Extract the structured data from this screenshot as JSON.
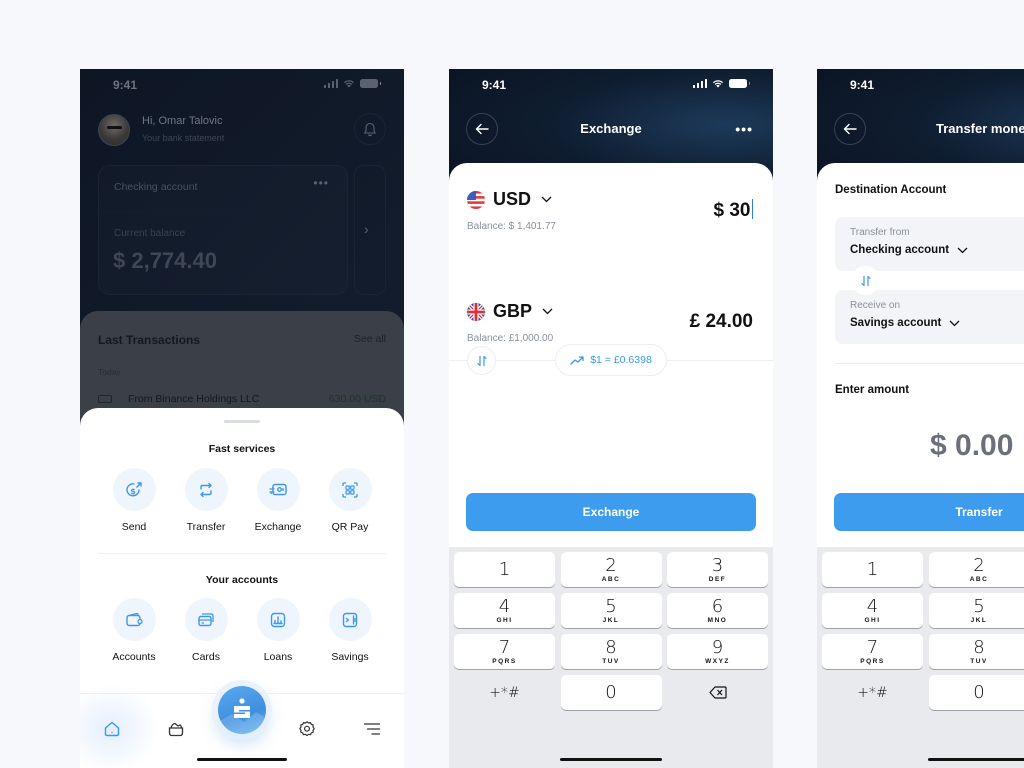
{
  "status_bar": {
    "time": "9:41"
  },
  "home": {
    "greeting": "Hi, Omar Talovic",
    "greeting_sub": "Your bank statement",
    "account_card": {
      "name": "Checking account",
      "balance_label": "Current balance",
      "balance": "$ 2,774.40"
    },
    "transactions": {
      "title": "Last Transactions",
      "see_all": "See all",
      "group": "Today",
      "items": [
        {
          "name": "From Binance Holdings LLC",
          "amount": "630.00 USD"
        }
      ]
    },
    "sheet": {
      "fast_services_title": "Fast services",
      "fast_services": [
        {
          "label": "Send",
          "icon": "send-money-icon"
        },
        {
          "label": "Transfer",
          "icon": "transfer-icon"
        },
        {
          "label": "Exchange",
          "icon": "exchange-icon"
        },
        {
          "label": "QR Pay",
          "icon": "qr-icon"
        }
      ],
      "accounts_title": "Your accounts",
      "accounts": [
        {
          "label": "Accounts",
          "icon": "wallet-icon"
        },
        {
          "label": "Cards",
          "icon": "cards-icon"
        },
        {
          "label": "Loans",
          "icon": "loans-icon"
        },
        {
          "label": "Savings",
          "icon": "savings-icon"
        }
      ]
    },
    "tabbar": [
      {
        "name": "home",
        "active": true
      },
      {
        "name": "wallet",
        "active": false
      },
      {
        "name": "main",
        "active": false
      },
      {
        "name": "settings",
        "active": false
      },
      {
        "name": "menu",
        "active": false
      }
    ]
  },
  "exchange": {
    "title": "Exchange",
    "from": {
      "code": "USD",
      "balance": "Balance: $ 1,401.77",
      "amount": "$ 30"
    },
    "rate": "$1 = £0.6398",
    "to": {
      "code": "GBP",
      "balance": "Balance: £1,000.00",
      "amount": "£ 24.00"
    },
    "button": "Exchange"
  },
  "transfer": {
    "title": "Transfer money",
    "destination_title": "Destination Account",
    "from_label": "Transfer from",
    "from_value": "Checking account",
    "to_label": "Receive on",
    "to_value": "Savings account",
    "amount_label": "Enter amount",
    "amount": "$ 0.00",
    "button": "Transfer"
  },
  "keypad": {
    "keys": [
      {
        "digit": "1",
        "letters": ""
      },
      {
        "digit": "2",
        "letters": "ABC"
      },
      {
        "digit": "3",
        "letters": "DEF"
      },
      {
        "digit": "4",
        "letters": "GHI"
      },
      {
        "digit": "5",
        "letters": "JKL"
      },
      {
        "digit": "6",
        "letters": "MNO"
      },
      {
        "digit": "7",
        "letters": "PQRS"
      },
      {
        "digit": "8",
        "letters": "TUV"
      },
      {
        "digit": "9",
        "letters": "WXYZ"
      },
      {
        "digit": "+*#",
        "letters": ""
      },
      {
        "digit": "0",
        "letters": ""
      },
      {
        "digit": "",
        "letters": ""
      }
    ]
  },
  "colors": {
    "accent": "#3d9ced",
    "background": "#f6f8fc",
    "header_dark": "#0f1d30"
  }
}
